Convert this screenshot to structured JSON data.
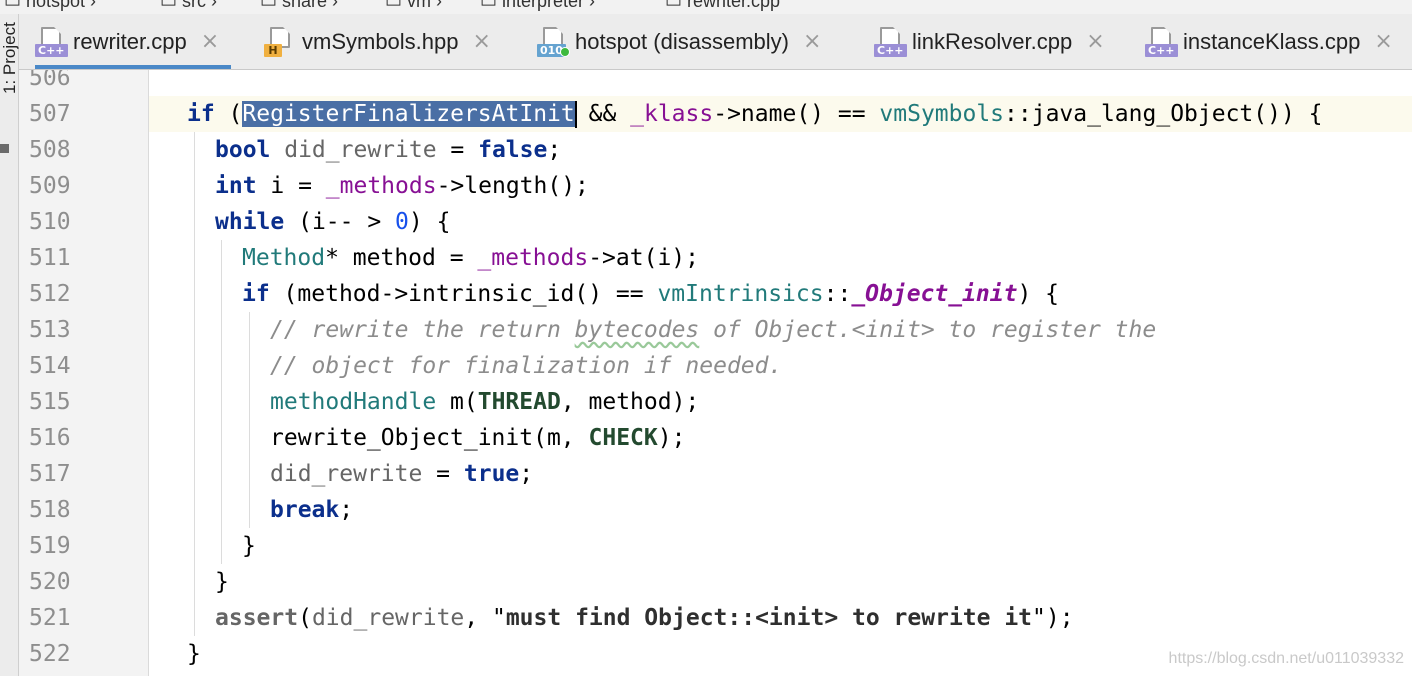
{
  "sidebar": {
    "project_label": "1: Project"
  },
  "tabs": [
    {
      "label": "rewriter.cpp",
      "badge": "C++",
      "close": "×",
      "active": true
    },
    {
      "label": "vmSymbols.hpp",
      "badge": "H",
      "close": "×",
      "active": false
    },
    {
      "label": "hotspot (disassembly)",
      "badge": "010",
      "close": "×",
      "active": false
    },
    {
      "label": "linkResolver.cpp",
      "badge": "C++",
      "close": "×",
      "active": false
    },
    {
      "label": "instanceKlass.cpp",
      "badge": "C++",
      "close": "×",
      "active": false
    }
  ],
  "editor": {
    "line_numbers": [
      "506",
      "507",
      "508",
      "509",
      "510",
      "511",
      "512",
      "513",
      "514",
      "515",
      "516",
      "517",
      "518",
      "519",
      "520",
      "521",
      "522"
    ],
    "current_line": "507",
    "selected_text": "RegisterFinalizersAtInit"
  },
  "code": {
    "l506": "",
    "l507": {
      "kw": "if",
      "p1": " (",
      "sel": "RegisterFinalizersAtInit",
      "p2": " && ",
      "mem": "_klass",
      "p3": "->name() == ",
      "ty": "vmSymbols",
      "p4": "::java_lang_Object()) {"
    },
    "l508": {
      "kw": "bool",
      "grey": " did_rewrite",
      "p1": " = ",
      "kw2": "false",
      "p2": ";"
    },
    "l509": {
      "kw": "int",
      "p1": " i = ",
      "mem": "_methods",
      "p2": "->length();"
    },
    "l510": {
      "kw": "while",
      "p1": " (i-- > ",
      "num": "0",
      "p2": ") {"
    },
    "l511": {
      "ty": "Method",
      "p1": "* method = ",
      "mem": "_methods",
      "p2": "->at(i);"
    },
    "l512": {
      "kw": "if",
      "p1": " (method->intrinsic_id() == ",
      "ty": "vmIntrinsics",
      "p2": "::",
      "em": "_Object_init",
      "p3": ") {"
    },
    "l513": {
      "c1": "// rewrite the return ",
      "c2": "bytecodes",
      "c3": " of Object.<init> to register the"
    },
    "l514": {
      "c1": "// object for finalization if needed."
    },
    "l515": {
      "ty": "methodHandle",
      "p1": " m(",
      "mac": "THREAD",
      "p2": ", method);"
    },
    "l516": {
      "p1": "rewrite_Object_init(m, ",
      "mac": "CHECK",
      "p2": ");"
    },
    "l517": {
      "grey": "did_rewrite",
      "p1": " = ",
      "kw": "true",
      "p2": ";"
    },
    "l518": {
      "kw": "break",
      "p1": ";"
    },
    "l519": {
      "p1": "}"
    },
    "l520": {
      "p1": "}"
    },
    "l521": {
      "grey": "assert",
      "p1": "(",
      "grey2": "did_rewrite",
      "p2": ", \"",
      "str": "must find Object::<init> to rewrite it",
      "p3": "\");"
    },
    "l522": {
      "p1": "}"
    }
  },
  "watermark": "https://blog.csdn.net/u011039332"
}
